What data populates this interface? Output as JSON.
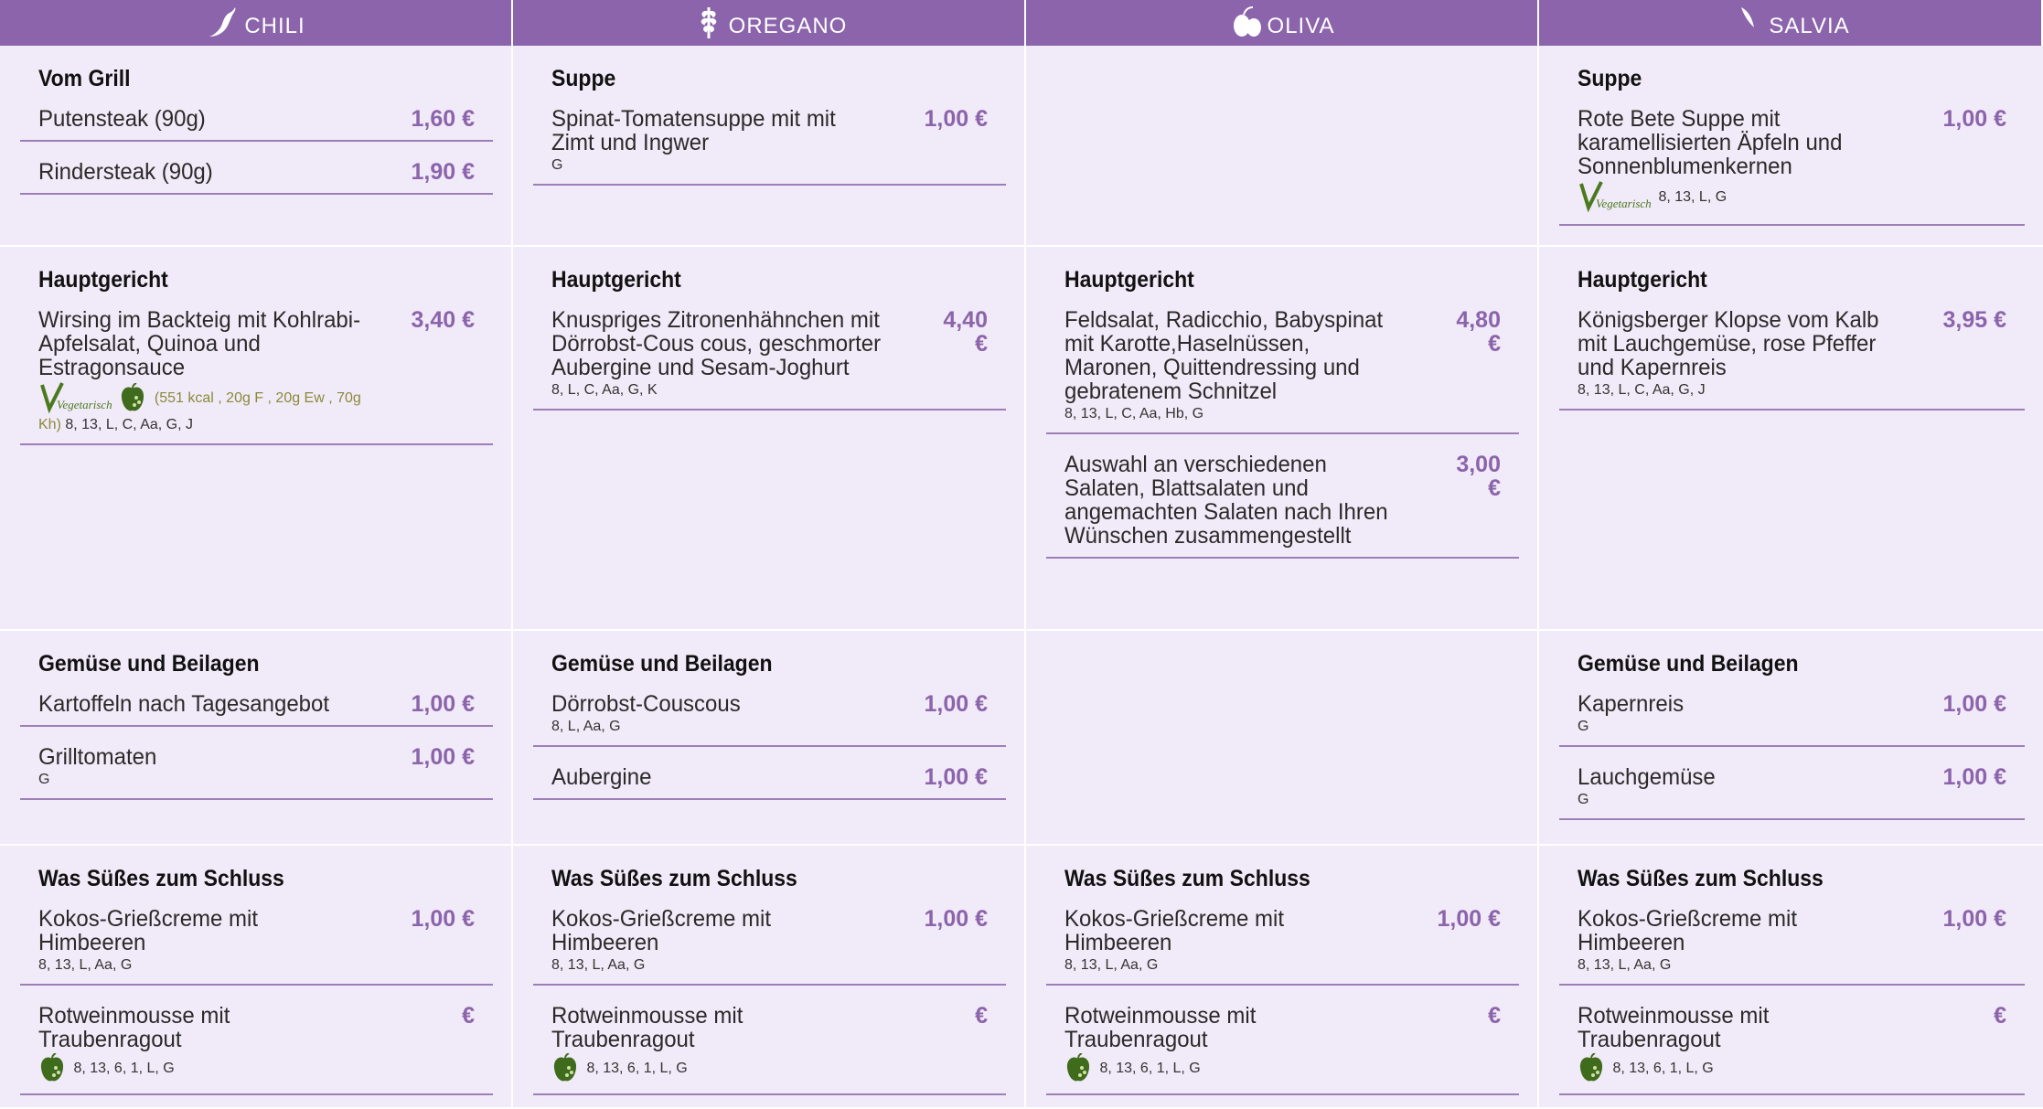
{
  "columns": [
    {
      "name": "CHILI",
      "icon": "chili-icon"
    },
    {
      "name": "OREGANO",
      "icon": "oregano-icon"
    },
    {
      "name": "OLIVA",
      "icon": "olive-icon"
    },
    {
      "name": "SALVIA",
      "icon": "sage-icon"
    }
  ],
  "colors": {
    "header": "#8b64ab",
    "cell_bg": "#f1eaf8",
    "price": "#8b64ab",
    "veg_green": "#4a7a1e"
  },
  "badge_text": {
    "vegetarisch": "Vegetarisch"
  },
  "rows": {
    "r1": {
      "chili": {
        "title": "Vom Grill",
        "items": [
          {
            "name": "Putensteak (90g)",
            "price": "1,60 €"
          },
          {
            "name": "Rindersteak (90g)",
            "price": "1,90 €"
          }
        ]
      },
      "oregano": {
        "title": "Suppe",
        "items": [
          {
            "name": "Spinat-Tomatensuppe mit mit Zimt und Ingwer",
            "price": "1,00 €",
            "meta": "G"
          }
        ]
      },
      "salvia": {
        "title": "Suppe",
        "items": [
          {
            "name": "Rote Bete Suppe mit karamellisierten Äpfeln und Sonnenblumenkernen",
            "price": "1,00 €",
            "meta": "8, 13, L, G"
          }
        ]
      }
    },
    "r2": {
      "chili": {
        "title": "Hauptgericht",
        "items": [
          {
            "name": "Wirsing im Backteig mit Kohlrabi-Apfelsalat, Quinoa und Estragonsauce",
            "price": "3,40 €",
            "nutrition": "(551 kcal , 20g F , 20g Ew , 70g Kh)",
            "meta": "8, 13, L, C, Aa, G, J"
          }
        ]
      },
      "oregano": {
        "title": "Hauptgericht",
        "items": [
          {
            "name": "Knuspriges Zitronenhähnchen mit Dörrobst-Cous cous, geschmorter Aubergine und Sesam-Joghurt",
            "price": "4,40 €",
            "meta": "8, L, C, Aa, G, K"
          }
        ]
      },
      "oliva": {
        "title": "Hauptgericht",
        "items": [
          {
            "name": "Feldsalat, Radicchio, Babyspinat mit Karotte,Haselnüssen, Maronen, Quittendressing und gebratenem Schnitzel",
            "price": "4,80 €",
            "meta": "8, 13, L, C, Aa, Hb, G"
          },
          {
            "name": "Auswahl an verschiedenen Salaten, Blattsalaten und angemachten Salaten nach Ihren Wünschen zusammengestellt",
            "price": "3,00 €"
          }
        ]
      },
      "salvia": {
        "title": "Hauptgericht",
        "items": [
          {
            "name": "Königsberger Klopse vom Kalb mit Lauchgemüse, rose Pfeffer und Kapernreis",
            "price": "3,95 €",
            "meta": "8, 13, L, C, Aa, G, J"
          }
        ]
      }
    },
    "r3": {
      "chili": {
        "title": "Gemüse und Beilagen",
        "items": [
          {
            "name": "Kartoffeln nach Tagesangebot",
            "price": "1,00 €"
          },
          {
            "name": "Grilltomaten",
            "price": "1,00 €",
            "meta": "G"
          }
        ]
      },
      "oregano": {
        "title": "Gemüse und Beilagen",
        "items": [
          {
            "name": "Dörrobst-Couscous",
            "price": "1,00 €",
            "meta": "8, L, Aa, G"
          },
          {
            "name": "Aubergine",
            "price": "1,00 €"
          }
        ]
      },
      "salvia": {
        "title": "Gemüse und Beilagen",
        "items": [
          {
            "name": "Kapernreis",
            "price": "1,00 €",
            "meta": "G"
          },
          {
            "name": "Lauchgemüse",
            "price": "1,00 €",
            "meta": "G"
          }
        ]
      }
    },
    "r4": {
      "dessert_title": "Was Süßes zum Schluss",
      "item1": {
        "name": "Kokos-Grießcreme mit Himbeeren",
        "price": "1,00 €",
        "meta": "8, 13, L, Aa, G"
      },
      "item2": {
        "name": "Rotweinmousse mit Traubenragout",
        "price": "€",
        "meta": "8, 13, 6, 1, L, G"
      }
    }
  }
}
